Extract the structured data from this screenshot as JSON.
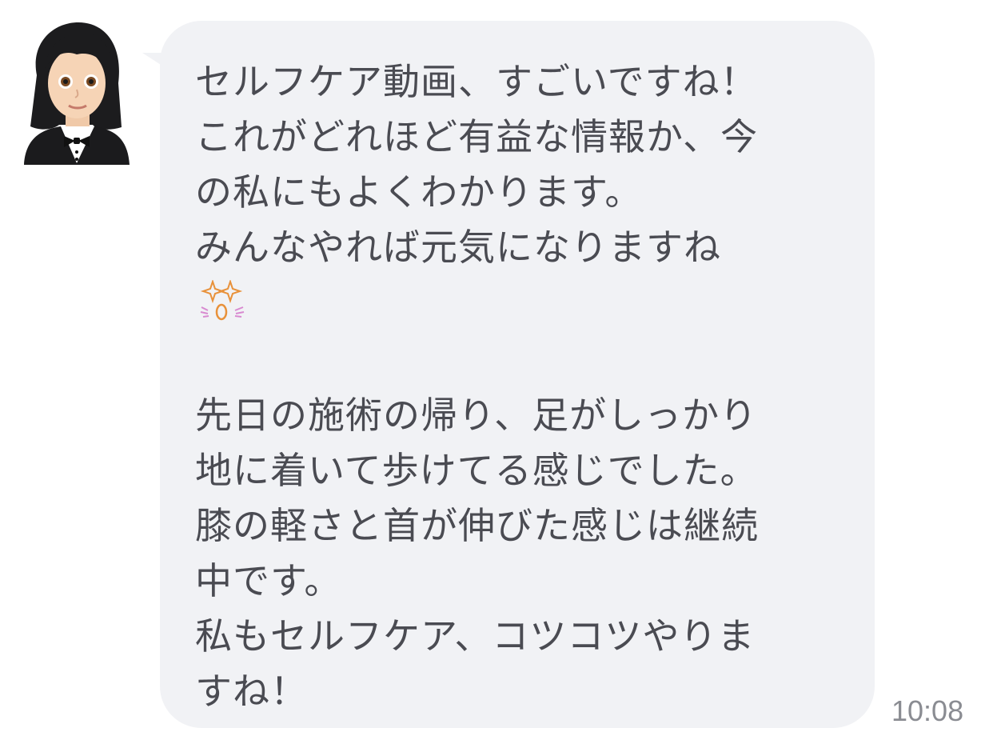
{
  "message": {
    "lines_block1": [
      "セルフケア動画、すごいですね！",
      "これがどれほど有益な情報か、今",
      "の私にもよくわかります。",
      "みんなやれば元気になりますね"
    ],
    "emoji": "sparkle-eyes-face",
    "lines_block2": [
      "先日の施術の帰り、足がしっかり",
      "地に着いて歩けてる感じでした。",
      "膝の軽さと首が伸びた感じは継続",
      "中です。",
      "私もセルフケア、コツコツやりま",
      "すね！"
    ],
    "time": "10:08"
  },
  "sender": {
    "avatar_icon": "woman-in-tuxedo-emoji"
  },
  "colors": {
    "bubble": "#f1f2f5",
    "text": "#4a4b52",
    "time": "#8a8c92"
  }
}
